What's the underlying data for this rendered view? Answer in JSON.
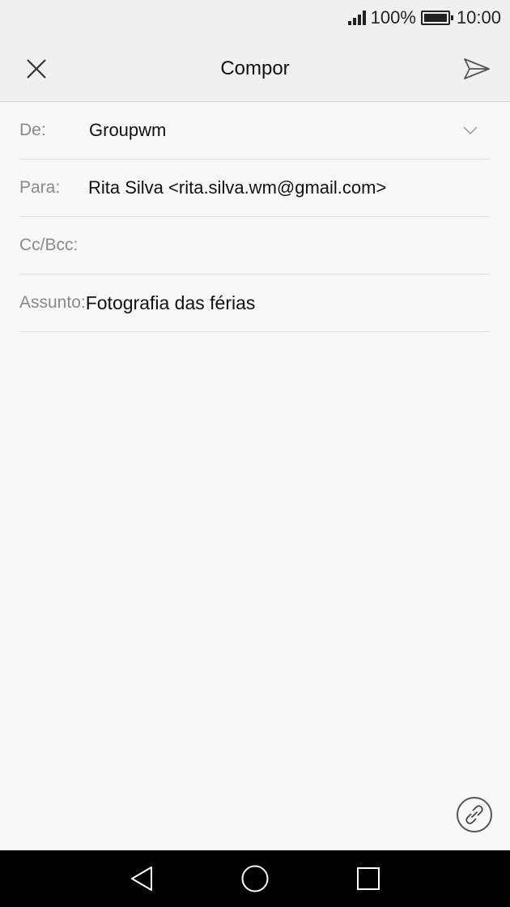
{
  "status_bar": {
    "battery_percent": "100%",
    "time": "10:00",
    "icons": [
      "signal-icon",
      "battery-icon"
    ]
  },
  "header": {
    "title": "Compor",
    "close_icon": "close-icon",
    "send_icon": "send-icon"
  },
  "form": {
    "from": {
      "label": "De:",
      "value": "Groupwm",
      "icon": "chevron-down-icon"
    },
    "to": {
      "label": "Para:",
      "value": "Rita Silva <rita.silva.wm@gmail.com>"
    },
    "cc": {
      "label": "Cc/Bcc:",
      "value": ""
    },
    "subject": {
      "label": "Assunto:",
      "value": "Fotografia das férias"
    }
  },
  "body": {
    "value": ""
  },
  "attach_icon": "attachment-icon",
  "nav_bar": {
    "icons": [
      "back-icon",
      "home-icon",
      "recent-apps-icon"
    ]
  },
  "colors": {
    "status_bg": "#f0f0f0",
    "page_bg": "#f8f8f8",
    "label": "#8a8a8a",
    "nav_bg": "#000000"
  }
}
